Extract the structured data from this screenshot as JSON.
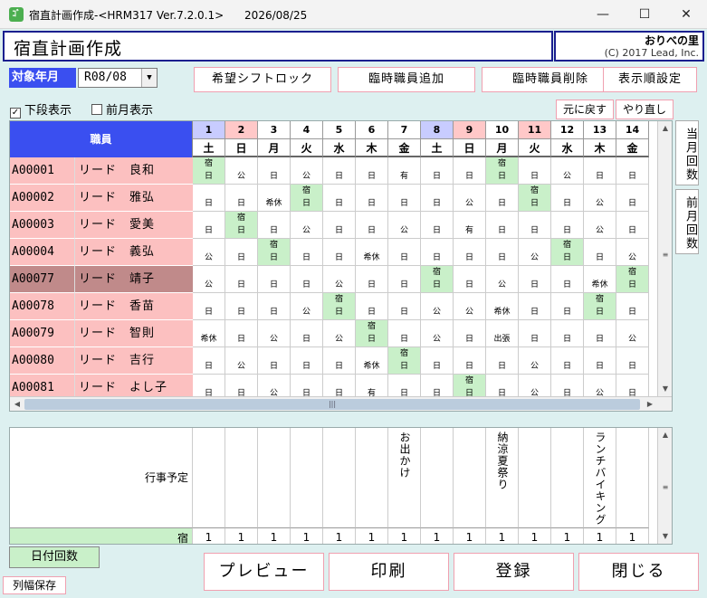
{
  "window": {
    "title": "宿直計画作成-<HRM317 Ver.7.2.0.1>      2026/08/25",
    "minimize": "—",
    "maximize": "☐",
    "close": "✕",
    "app_icon": "ｺﾞ"
  },
  "header": {
    "title": "宿直計画作成",
    "brand_name": "おりべの里",
    "brand_copy": "(C) 2017 Lead, Inc."
  },
  "controls": {
    "ym_label": "対象年月",
    "ym_value": "R08/08",
    "lock_btn": "希望シフトロック",
    "add_temp_btn": "臨時職員追加",
    "del_temp_btn": "臨時職員削除",
    "order_btn": "表示順設定",
    "lower_check_label": "下段表示",
    "lower_check": "✓",
    "prev_month_label": "前月表示",
    "undo_btn": "元に戻す",
    "redo_btn": "やり直し",
    "this_month_btn": "当月回数",
    "prev_month_btn": "前月回数"
  },
  "grid": {
    "staff_header": "職員",
    "days": [
      {
        "d": "1",
        "w": "土",
        "c": "#c8ccff"
      },
      {
        "d": "2",
        "w": "日",
        "c": "#ffc8c8"
      },
      {
        "d": "3",
        "w": "月",
        "c": "#ffffff"
      },
      {
        "d": "4",
        "w": "火",
        "c": "#ffffff"
      },
      {
        "d": "5",
        "w": "水",
        "c": "#ffffff"
      },
      {
        "d": "6",
        "w": "木",
        "c": "#ffffff"
      },
      {
        "d": "7",
        "w": "金",
        "c": "#ffffff"
      },
      {
        "d": "8",
        "w": "土",
        "c": "#c8ccff"
      },
      {
        "d": "9",
        "w": "日",
        "c": "#ffc8c8"
      },
      {
        "d": "10",
        "w": "月",
        "c": "#ffffff"
      },
      {
        "d": "11",
        "w": "火",
        "c": "#ffc8c8"
      },
      {
        "d": "12",
        "w": "水",
        "c": "#ffffff"
      },
      {
        "d": "13",
        "w": "木",
        "c": "#ffffff"
      },
      {
        "d": "14",
        "w": "金",
        "c": "#ffffff"
      }
    ],
    "staff": [
      {
        "id": "A00001",
        "name": "リード　良和",
        "sel": false,
        "cells": [
          [
            "宿",
            "日"
          ],
          [
            "",
            "公"
          ],
          [
            "",
            "日"
          ],
          [
            "",
            "公"
          ],
          [
            "",
            "日"
          ],
          [
            "",
            "日"
          ],
          [
            "",
            "有"
          ],
          [
            "",
            "日"
          ],
          [
            "",
            "日"
          ],
          [
            "宿",
            "日"
          ],
          [
            "",
            "日"
          ],
          [
            "",
            "公"
          ],
          [
            "",
            "日"
          ],
          [
            "",
            "日"
          ]
        ]
      },
      {
        "id": "A00002",
        "name": "リード　雅弘",
        "sel": false,
        "cells": [
          [
            "",
            "日"
          ],
          [
            "",
            "日"
          ],
          [
            "",
            "希休"
          ],
          [
            "宿",
            "日"
          ],
          [
            "",
            "日"
          ],
          [
            "",
            "日"
          ],
          [
            "",
            "日"
          ],
          [
            "",
            "日"
          ],
          [
            "",
            "公"
          ],
          [
            "",
            "日"
          ],
          [
            "宿",
            "日"
          ],
          [
            "",
            "日"
          ],
          [
            "",
            "公"
          ],
          [
            "",
            "日"
          ]
        ]
      },
      {
        "id": "A00003",
        "name": "リード　愛美",
        "sel": false,
        "cells": [
          [
            "",
            "日"
          ],
          [
            "宿",
            "日"
          ],
          [
            "",
            "日"
          ],
          [
            "",
            "公"
          ],
          [
            "",
            "日"
          ],
          [
            "",
            "日"
          ],
          [
            "",
            "公"
          ],
          [
            "",
            "日"
          ],
          [
            "",
            "有"
          ],
          [
            "",
            "日"
          ],
          [
            "",
            "日"
          ],
          [
            "",
            "日"
          ],
          [
            "",
            "公"
          ],
          [
            "",
            "日"
          ]
        ]
      },
      {
        "id": "A00004",
        "name": "リード　義弘",
        "sel": false,
        "cells": [
          [
            "",
            "公"
          ],
          [
            "",
            "日"
          ],
          [
            "宿",
            "日"
          ],
          [
            "",
            "日"
          ],
          [
            "",
            "日"
          ],
          [
            "",
            "希休"
          ],
          [
            "",
            "日"
          ],
          [
            "",
            "日"
          ],
          [
            "",
            "日"
          ],
          [
            "",
            "日"
          ],
          [
            "",
            "公"
          ],
          [
            "宿",
            "日"
          ],
          [
            "",
            "日"
          ],
          [
            "",
            "公"
          ]
        ]
      },
      {
        "id": "A00077",
        "name": "リード　靖子",
        "sel": true,
        "cells": [
          [
            "",
            "公"
          ],
          [
            "",
            "日"
          ],
          [
            "",
            "日"
          ],
          [
            "",
            "日"
          ],
          [
            "",
            "公"
          ],
          [
            "",
            "日"
          ],
          [
            "",
            "日"
          ],
          [
            "宿",
            "日"
          ],
          [
            "",
            "日"
          ],
          [
            "",
            "公"
          ],
          [
            "",
            "日"
          ],
          [
            "",
            "日"
          ],
          [
            "",
            "希休"
          ],
          [
            "宿",
            "日"
          ]
        ]
      },
      {
        "id": "A00078",
        "name": "リード　香苗",
        "sel": false,
        "cells": [
          [
            "",
            "日"
          ],
          [
            "",
            "日"
          ],
          [
            "",
            "日"
          ],
          [
            "",
            "公"
          ],
          [
            "宿",
            "日"
          ],
          [
            "",
            "日"
          ],
          [
            "",
            "日"
          ],
          [
            "",
            "公"
          ],
          [
            "",
            "公"
          ],
          [
            "",
            "希休"
          ],
          [
            "",
            "日"
          ],
          [
            "",
            "日"
          ],
          [
            "宿",
            "日"
          ],
          [
            "",
            "日"
          ]
        ]
      },
      {
        "id": "A00079",
        "name": "リード　智則",
        "sel": false,
        "cells": [
          [
            "",
            "希休"
          ],
          [
            "",
            "日"
          ],
          [
            "",
            "公"
          ],
          [
            "",
            "日"
          ],
          [
            "",
            "公"
          ],
          [
            "宿",
            "日"
          ],
          [
            "",
            "日"
          ],
          [
            "",
            "公"
          ],
          [
            "",
            "日"
          ],
          [
            "",
            "出張"
          ],
          [
            "",
            "日"
          ],
          [
            "",
            "日"
          ],
          [
            "",
            "日"
          ],
          [
            "",
            "公"
          ]
        ]
      },
      {
        "id": "A00080",
        "name": "リード　吉行",
        "sel": false,
        "cells": [
          [
            "",
            "日"
          ],
          [
            "",
            "公"
          ],
          [
            "",
            "日"
          ],
          [
            "",
            "日"
          ],
          [
            "",
            "日"
          ],
          [
            "",
            "希休"
          ],
          [
            "宿",
            "日"
          ],
          [
            "",
            "日"
          ],
          [
            "",
            "日"
          ],
          [
            "",
            "日"
          ],
          [
            "",
            "公"
          ],
          [
            "",
            "日"
          ],
          [
            "",
            "日"
          ],
          [
            "",
            "日"
          ]
        ]
      },
      {
        "id": "A00081",
        "name": "リード　よし子",
        "sel": false,
        "cells": [
          [
            "",
            "日"
          ],
          [
            "",
            "日"
          ],
          [
            "",
            "公"
          ],
          [
            "",
            "日"
          ],
          [
            "",
            "日"
          ],
          [
            "",
            "有"
          ],
          [
            "",
            "日"
          ],
          [
            "",
            "日"
          ],
          [
            "宿",
            "日"
          ],
          [
            "",
            "日"
          ],
          [
            "",
            "公"
          ],
          [
            "",
            "日"
          ],
          [
            "",
            "公"
          ],
          [
            "",
            "日"
          ]
        ]
      }
    ],
    "hscroll_grip": "|||",
    "vscroll_grip": "≡",
    "arrow_up": "▲",
    "arrow_down": "▼",
    "arrow_left": "◀",
    "arrow_right": "▶"
  },
  "lower": {
    "event_label": "行事予定",
    "events": [
      "",
      "",
      "",
      "",
      "",
      "",
      "お出かけ",
      "",
      "",
      "納涼夏祭り",
      "",
      "",
      "ランチバイキング",
      ""
    ],
    "shuku_label": "宿",
    "shuku_counts": [
      "1",
      "1",
      "1",
      "1",
      "1",
      "1",
      "1",
      "1",
      "1",
      "1",
      "1",
      "1",
      "1",
      "1"
    ]
  },
  "footer": {
    "date_count_btn": "日付回数",
    "col_save_btn": "列幅保存",
    "preview_btn": "プレビュー",
    "print_btn": "印刷",
    "register_btn": "登録",
    "close_btn": "閉じる"
  }
}
